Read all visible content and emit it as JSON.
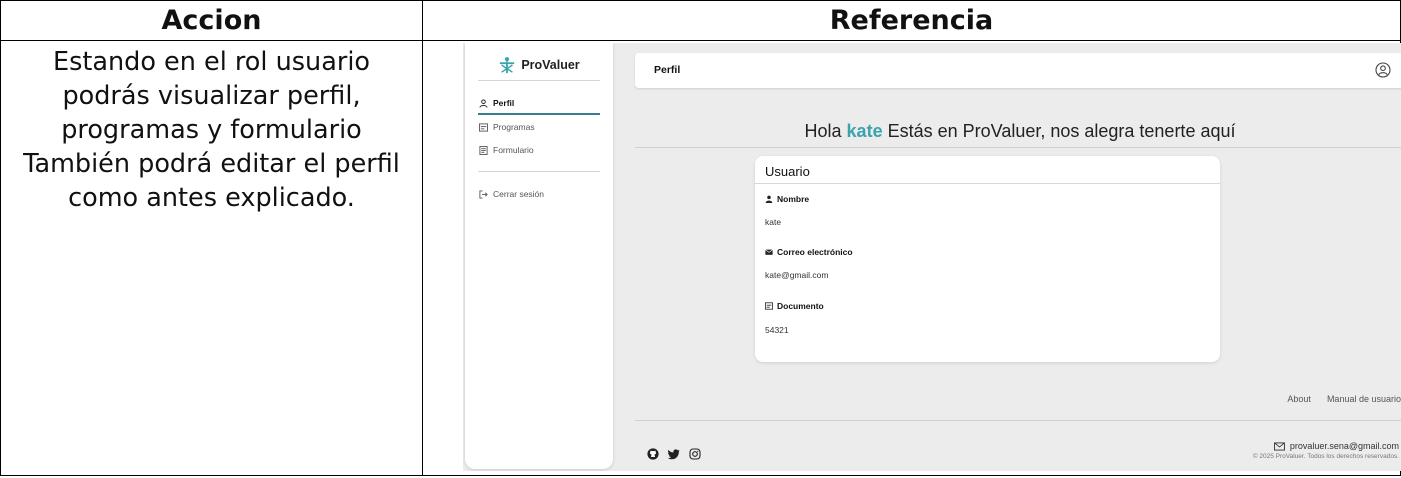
{
  "table": {
    "header_action": "Accion",
    "header_reference": "Referencia",
    "action_text": "Estando en el rol usuario podrás visualizar perfil, programas y formulario También podrá editar el perfil como antes explicado."
  },
  "app": {
    "brand": "ProValuer",
    "sidebar": {
      "items": [
        {
          "label": "Perfil",
          "icon": "user-icon"
        },
        {
          "label": "Programas",
          "icon": "list-icon"
        },
        {
          "label": "Formulario",
          "icon": "form-icon"
        }
      ],
      "logout": "Cerrar sesión"
    },
    "topbar_title": "Perfil",
    "greeting": {
      "prefix": "Hola",
      "name": "kate",
      "suffix": "Estás en ProValuer, nos alegra tenerte aquí"
    },
    "card": {
      "title": "Usuario",
      "fields": [
        {
          "label": "Nombre",
          "value": "kate"
        },
        {
          "label": "Correo electrónico",
          "value": "kate@gmail.com"
        },
        {
          "label": "Documento",
          "value": "54321"
        }
      ]
    },
    "footer": {
      "about": "About",
      "manual": "Manual de usuario",
      "email": "provaluer.sena@gmail.com",
      "copyright": "© 2025 ProValuer. Todos los derechos reservados."
    },
    "colors": {
      "accent": "#3aa3ad",
      "active_bar": "#3a7d90"
    }
  }
}
